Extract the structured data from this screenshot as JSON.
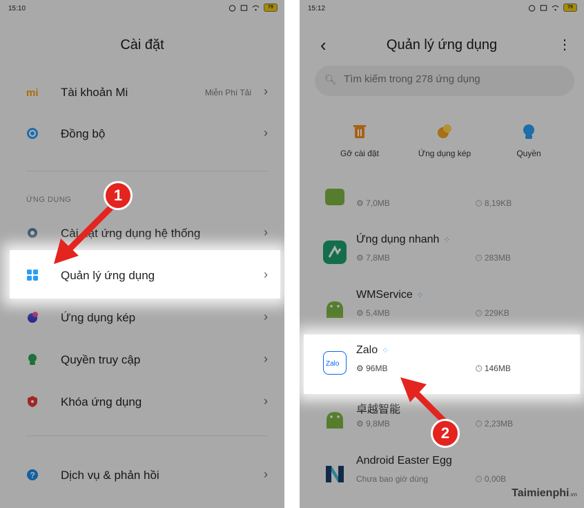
{
  "left": {
    "status_time": "15:10",
    "battery": "79",
    "title": "Cài đặt",
    "rows": [
      {
        "label": "Tài khoản Mi",
        "hint": "Miễn Phí Tải",
        "icon": "mi-logo-icon",
        "color": "#f39c12"
      },
      {
        "label": "Đồng bộ",
        "icon": "sync-icon",
        "color": "#2a9df4"
      },
      {
        "label": "Cài đặt ứng dụng hệ thống",
        "icon": "gear-icon",
        "color": "#5b7c99"
      },
      {
        "label": "Quản lý ứng dụng",
        "icon": "apps-grid-icon",
        "color": "#2a9df4"
      },
      {
        "label": "Ứng dụng kép",
        "icon": "dual-apps-icon",
        "color": "#3c3fc7"
      },
      {
        "label": "Quyền truy cập",
        "icon": "permissions-icon",
        "color": "#2aa352"
      },
      {
        "label": "Khóa ứng dụng",
        "icon": "shield-lock-icon",
        "color": "#e53935"
      },
      {
        "label": "Dịch vụ & phản hồi",
        "icon": "help-icon",
        "color": "#1e88e5"
      }
    ],
    "section_label": "ỨNG DỤNG",
    "step_badge": "1"
  },
  "right": {
    "status_time": "15:12",
    "battery": "79",
    "title": "Quản lý ứng dụng",
    "search_placeholder": "Tìm kiếm trong 278 ứng dụng",
    "actions": [
      {
        "label": "Gỡ cài đặt",
        "icon": "trash-icon",
        "color": "#f08c1e"
      },
      {
        "label": "Ứng dụng kép",
        "icon": "dual-apps-icon",
        "color": "#f0a020"
      },
      {
        "label": "Quyền",
        "icon": "permissions-icon",
        "color": "#2a9df4"
      }
    ],
    "apps": [
      {
        "name": "",
        "size": "7,0MB",
        "cache": "8,19KB",
        "icon": "android-icon",
        "color": "#7cb342"
      },
      {
        "name": "Ứng dụng nhanh",
        "size": "7,8MB",
        "cache": "283MB",
        "icon": "quick-app-icon",
        "color": "#1e9e6e"
      },
      {
        "name": "WMService",
        "size": "5,4MB",
        "cache": "229KB",
        "icon": "android-icon",
        "color": "#7cb342"
      },
      {
        "name": "Zalo",
        "size": "96MB",
        "cache": "146MB",
        "icon": "zalo-icon",
        "color": "#0068ff",
        "icon_text": "Zalo"
      },
      {
        "name": "卓越智能",
        "size": "9,8MB",
        "cache": "2,23MB",
        "icon": "android-icon",
        "color": "#7cb342"
      },
      {
        "name": "Android Easter Egg",
        "size": "Chưa bao giờ dùng",
        "cache": "0,00B",
        "icon": "android-n-icon",
        "color": "#1a3d6b"
      }
    ],
    "step_badge": "2",
    "watermark": "Taimienphi",
    "watermark_suffix": ".vn"
  },
  "colors": {
    "highlight": "#ffffff",
    "arrow": "#e4241f",
    "badge": "#e4241f"
  }
}
